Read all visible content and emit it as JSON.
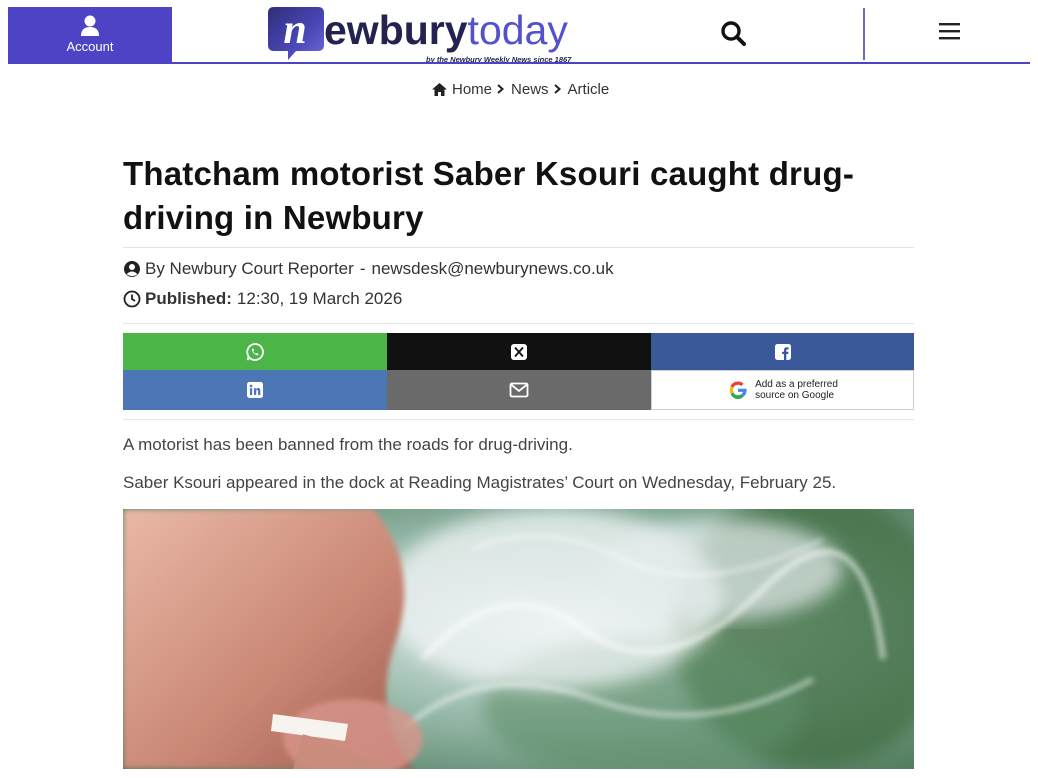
{
  "header": {
    "account_label": "Account",
    "logo": {
      "brand_bold": "ewbury",
      "brand_light": "today",
      "brand_initial": "n",
      "tagline": "by the Newbury Weekly News since 1867"
    }
  },
  "breadcrumb": {
    "items": [
      "Home",
      "News",
      "Article"
    ]
  },
  "article": {
    "title": "Thatcham motorist Saber Ksouri caught drug-driving in Newbury",
    "byline": "By Newbury Court Reporter",
    "byline_sep": "-",
    "email": "newsdesk@newburynews.co.uk",
    "published_label": "Published:",
    "published_value": "12:30, 19 March 2026",
    "paragraphs": [
      "A motorist has been banned from the roads for drug-driving.",
      "Saber Ksouri appeared in the dock at Reading Magistrates’ Court on Wednesday, February 25."
    ]
  },
  "share": {
    "google_line1": "Add as a preferred",
    "google_line2": "source on Google"
  },
  "colors": {
    "brand": "#4c44c5",
    "whatsapp": "#4cb548",
    "x": "#111111",
    "facebook": "#3b5998",
    "linkedin": "#4c76b6",
    "email": "#6a6a6a"
  }
}
